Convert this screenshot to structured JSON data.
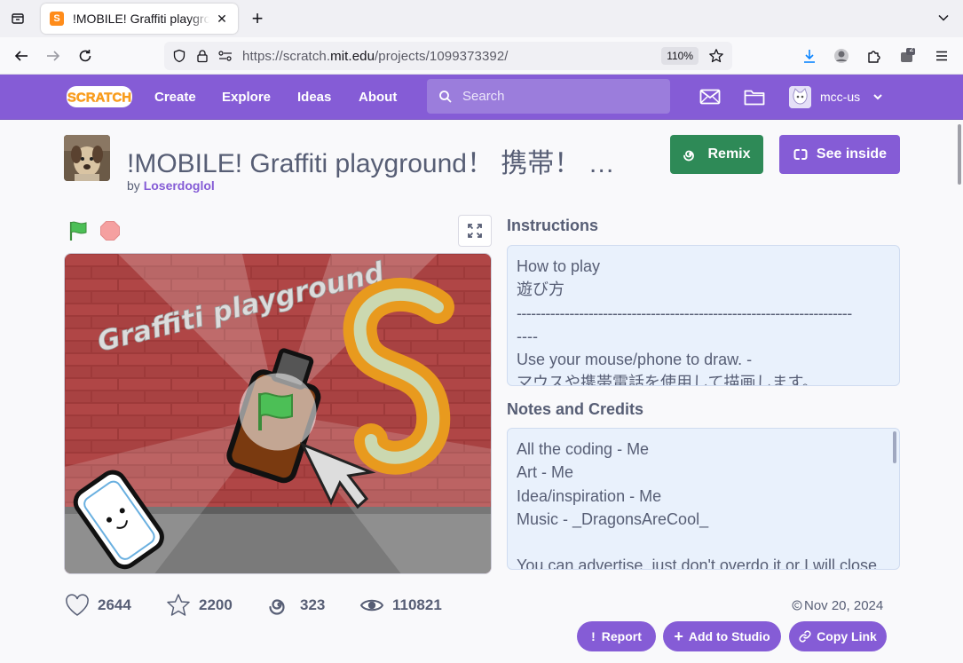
{
  "browser": {
    "tab_title": "!MOBILE! Graffiti playground！ 携帯！ 落書き",
    "tab_favicon": "S",
    "url_prefix": "https://scratch.",
    "url_domain": "mit.edu",
    "url_path": "/projects/1099373392/",
    "zoom": "110%",
    "extensions_badge": "2"
  },
  "scratch_header": {
    "logo": "SCRATCH",
    "nav": [
      "Create",
      "Explore",
      "Ideas",
      "About"
    ],
    "search_placeholder": "Search",
    "username": "mcc-us"
  },
  "project": {
    "title": "!MOBILE! Graffiti playground！ 携帯！ …",
    "by_label": "by",
    "author": "Loserdoglol",
    "remix_label": "Remix",
    "see_inside_label": "See inside",
    "stage_text": "Graffiti playground"
  },
  "instructions": {
    "title": "Instructions",
    "lines": [
      "How to play",
      "遊び方",
      "----------------------------------------------------------------------",
      "----",
      "Use your mouse/phone to draw. -",
      "マウスや携帯電話を使用して描画します。"
    ]
  },
  "notes": {
    "title": "Notes and Credits",
    "lines": [
      "All the coding - Me",
      "Art - Me",
      "Idea/inspiration - Me",
      "Music - _DragonsAreCool_",
      "",
      "You can advertise, just don't overdo it or I will close"
    ]
  },
  "stats": {
    "loves": "2644",
    "favorites": "2200",
    "remixes": "323",
    "views": "110821"
  },
  "date": "Nov 20, 2024",
  "actions": {
    "report": "Report",
    "add_to_studio": "Add to Studio",
    "copy_link": "Copy Link"
  },
  "colors": {
    "scratch_purple": "#855cd6",
    "remix_green": "#2e8a57",
    "text": "#575e75",
    "textbox_bg": "#e9f1fc"
  }
}
